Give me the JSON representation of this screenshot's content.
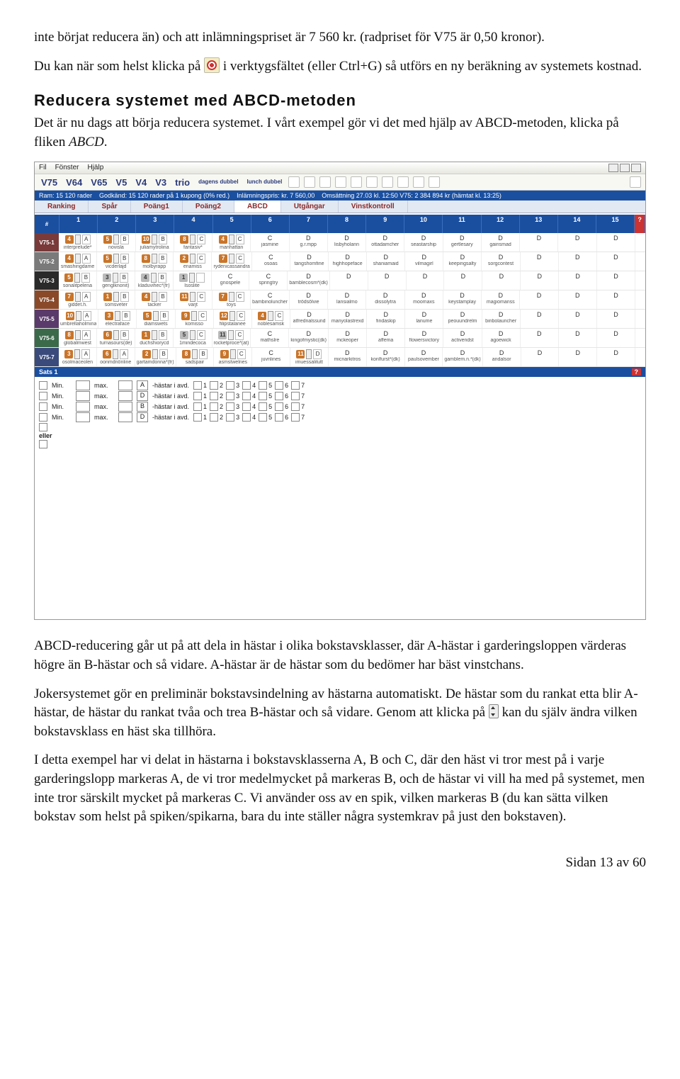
{
  "intro": {
    "p1a": "inte börjat reducera än) och att inlämningspriset är 7 560 kr. (radpriset för V75 är 0,50 kronor).",
    "p2a": "Du kan när som helst klicka på ",
    "p2b": " i verktygsfältet (eller Ctrl+G) så utförs en ny beräkning av systemets kostnad."
  },
  "heading": "Reducera systemet med ABCD-metoden",
  "after_heading": {
    "p1a": "Det är nu dags att börja reducera systemet. I vårt exempel gör vi det med hjälp av ABCD-metoden, klicka på fliken ",
    "p1b": "ABCD",
    "p1c": "."
  },
  "app": {
    "menu": {
      "file": "Fil",
      "window": "Fönster",
      "help": "Hjälp"
    },
    "games": [
      "V75",
      "V64",
      "V65",
      "V5",
      "V4",
      "V3",
      "trio",
      "dagens dubbel",
      "lunch dubbel"
    ],
    "status": {
      "s1": "Ram: 15 120 rader",
      "s2": "Godkänd: 15 120 rader på 1 kupong (0% red.)",
      "s3": "Inlämningspris: kr. 7 560,00",
      "s4": "Omsättning 27.03 kl. 12:50 V75: 2 384 894 kr (hämtat kl. 13:25)"
    },
    "tabs": [
      "Ranking",
      "Spår",
      "Poäng1",
      "Poäng2",
      "ABCD",
      "Utgångar",
      "Vinstkontroll"
    ],
    "activeTab": "ABCD",
    "gridHeader": {
      "rcol": "#",
      "cols": [
        "1",
        "2",
        "3",
        "4",
        "5",
        "6",
        "7",
        "8",
        "9",
        "10",
        "11",
        "12",
        "13",
        "14",
        "15"
      ],
      "q": "?"
    },
    "races": [
      {
        "id": "V75-1",
        "cls": "c1",
        "cells": [
          {
            "chips": [
              {
                "n": "4",
                "l": "A"
              }
            ],
            "hn": "interprelude*"
          },
          {
            "chips": [
              {
                "n": "5",
                "l": "B"
              }
            ],
            "hn": "novisla"
          },
          {
            "chips": [
              {
                "n": "10",
                "l": "B"
              }
            ],
            "hn": "juliamytrolina"
          },
          {
            "chips": [
              {
                "n": "8",
                "l": "C"
              }
            ],
            "hn": "fantasiv*"
          },
          {
            "chips": [
              {
                "n": "4",
                "l": "C"
              }
            ],
            "hn": "manhattan"
          },
          {
            "ltr": "C",
            "hn": "jasmine"
          },
          {
            "ltr": "D",
            "hn": "g.r.mpp"
          },
          {
            "ltr": "D",
            "hn": "lisbyholann"
          },
          {
            "ltr": "D",
            "hn": "ottadamcher"
          },
          {
            "ltr": "D",
            "hn": "seastarship"
          },
          {
            "ltr": "D",
            "hn": "gertlesary"
          },
          {
            "ltr": "D",
            "hn": "gainsmad"
          },
          {
            "ltr": "D"
          },
          {
            "ltr": "D"
          },
          {
            "ltr": "D"
          }
        ]
      },
      {
        "id": "V75-2",
        "cls": "c2",
        "cells": [
          {
            "chips": [
              {
                "n": "4",
                "l": "A"
              }
            ],
            "hn": "smashingdame"
          },
          {
            "chips": [
              {
                "n": "5",
                "l": "B"
              }
            ],
            "hn": "vicderlajd"
          },
          {
            "chips": [
              {
                "n": "8",
                "l": "B"
              }
            ],
            "hn": "molbyrapp"
          },
          {
            "chips": [
              {
                "n": "2",
                "l": "C"
              }
            ],
            "hn": "enamiss"
          },
          {
            "chips": [
              {
                "n": "7",
                "l": "C"
              }
            ],
            "hn": "rydenicassandra"
          },
          {
            "ltr": "C",
            "hn": "osoas"
          },
          {
            "ltr": "D",
            "hn": "tangshomfine"
          },
          {
            "ltr": "D",
            "hn": "highhopeface"
          },
          {
            "ltr": "D",
            "hn": "shaniamaid"
          },
          {
            "ltr": "D",
            "hn": "vilmagirl"
          },
          {
            "ltr": "D",
            "hn": "keepingsalty"
          },
          {
            "ltr": "D",
            "hn": "sorgcontest"
          },
          {
            "ltr": "D"
          },
          {
            "ltr": "D"
          },
          {
            "ltr": "D"
          }
        ]
      },
      {
        "id": "V75-3",
        "cls": "c3",
        "cells": [
          {
            "chips": [
              {
                "n": "5",
                "l": "B"
              }
            ],
            "hn": "sonalitpelena"
          },
          {
            "chips": [
              {
                "n": "3",
                "l": "B",
                "g": true
              }
            ],
            "hn": "genglknonit)"
          },
          {
            "chips": [
              {
                "n": "4",
                "l": "B",
                "g": true
              }
            ],
            "hn": "kladuvihec*(fr)"
          },
          {
            "chips": [
              {
                "n": "1",
                "l": " ",
                "g": true
              }
            ],
            "hn": "lsoslite"
          },
          {
            "ltr": "C",
            "hn": "gnospele"
          },
          {
            "ltr": "C",
            "hn": "springtry"
          },
          {
            "ltr": "D",
            "hn": "bamblecosm*(dk)"
          },
          {
            "ltr": "D"
          },
          {
            "ltr": "D"
          },
          {
            "ltr": "D"
          },
          {
            "ltr": "D"
          },
          {
            "ltr": "D"
          },
          {
            "ltr": "D"
          },
          {
            "ltr": "D"
          },
          {
            "ltr": "D"
          }
        ]
      },
      {
        "id": "V75-4",
        "cls": "c4",
        "cells": [
          {
            "chips": [
              {
                "n": "7",
                "l": "A"
              }
            ],
            "hn": "giddet.h."
          },
          {
            "chips": [
              {
                "n": "1",
                "l": "B"
              }
            ],
            "hn": "somsveter"
          },
          {
            "chips": [
              {
                "n": "4",
                "l": "B"
              }
            ],
            "hn": "tacker"
          },
          {
            "chips": [
              {
                "n": "11",
                "l": "C"
              }
            ],
            "hn": "varjt"
          },
          {
            "chips": [
              {
                "n": "7",
                "l": "C"
              }
            ],
            "hn": "toys"
          },
          {
            "ltr": "C",
            "hn": "bambinoluncher"
          },
          {
            "ltr": "D",
            "hn": "trödsölvie"
          },
          {
            "ltr": "D",
            "hn": "lansialmo"
          },
          {
            "ltr": "D",
            "hn": "dissolytra"
          },
          {
            "ltr": "D",
            "hn": "moomaxs"
          },
          {
            "ltr": "D",
            "hn": "keystamplay"
          },
          {
            "ltr": "D",
            "hn": "magiomanss"
          },
          {
            "ltr": "D"
          },
          {
            "ltr": "D"
          },
          {
            "ltr": "D"
          }
        ]
      },
      {
        "id": "V75-5",
        "cls": "c5",
        "cells": [
          {
            "chips": [
              {
                "n": "10",
                "l": "A"
              }
            ],
            "hn": "umbrellaholmina"
          },
          {
            "chips": [
              {
                "n": "3",
                "l": "B"
              }
            ],
            "hn": "electraface"
          },
          {
            "chips": [
              {
                "n": "5",
                "l": "B"
              }
            ],
            "hn": "diamswets"
          },
          {
            "chips": [
              {
                "n": "9",
                "l": "C"
              }
            ],
            "hn": "komisso"
          },
          {
            "chips": [
              {
                "n": "12",
                "l": "C"
              }
            ],
            "hn": "filipstalanee"
          },
          {
            "chips": [
              {
                "n": "4",
                "l": "C"
              }
            ],
            "hn": "noblesamsk"
          },
          {
            "ltr": "D",
            "hn": "atfrednalssund"
          },
          {
            "ltr": "D",
            "hn": "manyolastrexd"
          },
          {
            "ltr": "D",
            "hn": "findaskip"
          },
          {
            "ltr": "D",
            "hn": "lanume"
          },
          {
            "ltr": "D",
            "hn": "peouundrelm"
          },
          {
            "ltr": "D",
            "hn": "binbolauncher"
          },
          {
            "ltr": "D"
          },
          {
            "ltr": "D"
          },
          {
            "ltr": "D"
          }
        ]
      },
      {
        "id": "V75-6",
        "cls": "c6",
        "cells": [
          {
            "chips": [
              {
                "n": "8",
                "l": "A"
              }
            ],
            "hn": "globalmwest"
          },
          {
            "chips": [
              {
                "n": "6",
                "l": "B"
              }
            ],
            "hn": "turnasours(de)"
          },
          {
            "chips": [
              {
                "n": "1",
                "l": "B"
              }
            ],
            "hn": "duchshiorycd"
          },
          {
            "chips": [
              {
                "n": "5",
                "l": "C",
                "g": true
              }
            ],
            "hn": "1mindecoca"
          },
          {
            "chips": [
              {
                "n": "11",
                "l": "C",
                "g": true
              }
            ],
            "hn": "rocketproce*(at)"
          },
          {
            "ltr": "C",
            "hn": "mathslre"
          },
          {
            "ltr": "D",
            "hn": "kingofmystic(dk)"
          },
          {
            "ltr": "D",
            "hn": "mckeoper"
          },
          {
            "ltr": "D",
            "hn": "affema"
          },
          {
            "ltr": "D",
            "hn": "flowersvictory"
          },
          {
            "ltr": "D",
            "hn": "activendst"
          },
          {
            "ltr": "D",
            "hn": "agoewick"
          },
          {
            "ltr": "D"
          },
          {
            "ltr": "D"
          },
          {
            "ltr": "D"
          }
        ]
      },
      {
        "id": "V75-7",
        "cls": "c7",
        "cells": [
          {
            "chips": [
              {
                "n": "3",
                "l": "A"
              }
            ],
            "hn": "osolmaceolen"
          },
          {
            "chips": [
              {
                "n": "6",
                "l": "A"
              }
            ],
            "hn": "oonmdnönline"
          },
          {
            "chips": [
              {
                "n": "2",
                "l": "B"
              }
            ],
            "hn": "gartamdonna*(fr)"
          },
          {
            "chips": [
              {
                "n": "8",
                "l": "B"
              }
            ],
            "hn": "sadspair"
          },
          {
            "chips": [
              {
                "n": "9",
                "l": "C"
              }
            ],
            "hn": "asmstwelnes"
          },
          {
            "ltr": "C",
            "hn": "juvnlines"
          },
          {
            "chips": [
              {
                "n": "11",
                "l": "D"
              }
            ],
            "hn": "imuessalitutt"
          },
          {
            "ltr": "D",
            "hn": "micnarkitros"
          },
          {
            "ltr": "D",
            "hn": "konlfurst*(dk)"
          },
          {
            "ltr": "D",
            "hn": "paulsovember"
          },
          {
            "ltr": "D",
            "hn": "gamblem.n.*(dk)"
          },
          {
            "ltr": "D",
            "hn": "andalsor"
          },
          {
            "ltr": "D"
          },
          {
            "ltr": "D"
          },
          {
            "ltr": "D"
          }
        ]
      }
    ],
    "sats": {
      "title": "Sats 1",
      "q": "?",
      "rows": [
        {
          "min": "Min.",
          "max": "max.",
          "sel": "A",
          "txt": "-hästar i avd."
        },
        {
          "min": "Min.",
          "max": "max.",
          "sel": "D",
          "txt": "-hästar i avd."
        },
        {
          "min": "Min.",
          "max": "max.",
          "sel": "B",
          "txt": "-hästar i avd."
        },
        {
          "min": "Min.",
          "max": "max.",
          "sel": "D",
          "txt": "-hästar i avd."
        }
      ],
      "seq": [
        "1",
        "2",
        "3",
        "4",
        "5",
        "6",
        "7"
      ],
      "eller": "eller"
    }
  },
  "body": {
    "p3": "ABCD-reducering går ut på att dela in hästar i olika bokstavsklasser, där A-hästar i garderingsloppen värderas högre än B-hästar och så vidare. A-hästar är de hästar som du bedömer har bäst vinstchans.",
    "p4a": "Jokersystemet gör en preliminär bokstavsindelning av hästarna automatiskt. De hästar som du rankat etta blir A-hästar, de hästar du rankat tvåa och trea B-hästar och så vidare. Genom att klicka på ",
    "p4b": " kan du själv ändra vilken bokstavsklass en häst ska tillhöra.",
    "p5": "I detta exempel har vi delat in hästarna i bokstavsklasserna A, B och C, där den häst vi tror mest på i varje garderingslopp markeras A, de vi tror medelmycket på markeras B, och de hästar vi vill ha med på systemet, men inte tror särskilt mycket på markeras C. Vi använder oss av en spik, vilken markeras B (du kan sätta vilken bokstav som helst på spiken/spikarna, bara du inte ställer några systemkrav på just den bokstaven)."
  },
  "footer": "Sidan 13 av 60"
}
